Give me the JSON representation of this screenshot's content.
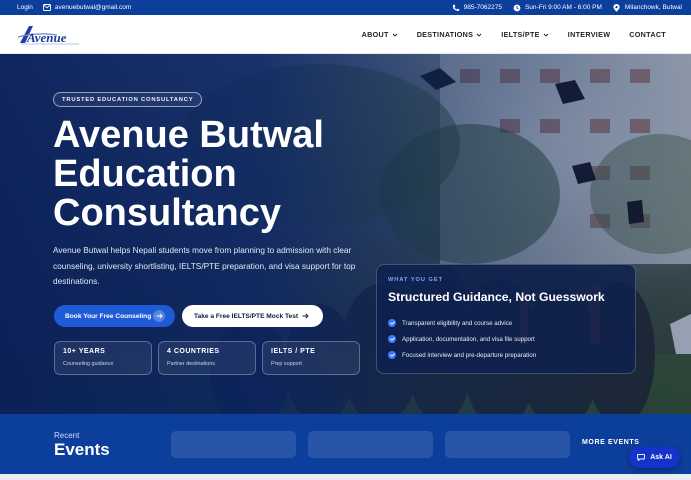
{
  "topbar": {
    "login": "Login",
    "email": "avenuebutwal@gmail.com",
    "phone": "985-7062275",
    "hours": "Sun-Fri 9:00 AM - 6:00 PM",
    "location": "Milanchowk, Butwal"
  },
  "brand": {
    "logo_text": "Avenue",
    "colors": {
      "primary": "#0c3e9c",
      "accent": "#1f5bd6"
    }
  },
  "nav": {
    "items": [
      {
        "label": "ABOUT",
        "dropdown": true
      },
      {
        "label": "DESTINATIONS",
        "dropdown": true
      },
      {
        "label": "IELTS/PTE",
        "dropdown": true
      },
      {
        "label": "INTERVIEW",
        "dropdown": false
      },
      {
        "label": "CONTACT",
        "dropdown": false
      }
    ]
  },
  "hero": {
    "badge": "TRUSTED EDUCATION CONSULTANCY",
    "title_line1": "Avenue Butwal",
    "title_line2": "Education",
    "title_line3": "Consultancy",
    "description": "Avenue Butwal helps Nepali students move from planning to admission with clear counseling, university shortlisting, IELTS/PTE preparation, and visa support for top destinations.",
    "cta_primary": "Book Your Free Counseling",
    "cta_secondary": "Take a Free IELTS/PTE Mock Test",
    "stats": [
      {
        "value": "10+ YEARS",
        "label": "Counseling guidance"
      },
      {
        "value": "4 COUNTRIES",
        "label": "Partner destinations"
      },
      {
        "value": "IELTS / PTE",
        "label": "Prep support"
      }
    ]
  },
  "card": {
    "eyebrow": "WHAT YOU GET",
    "title": "Structured Guidance, Not Guesswork",
    "items": [
      "Transparent eligibility and course advice",
      "Application, documentation, and visa file support",
      "Focused interview and pre-departure preparation"
    ]
  },
  "events": {
    "recent": "Recent",
    "title": "Events",
    "more": "MORE EVENTS"
  },
  "chat": {
    "label": "Ask AI"
  }
}
